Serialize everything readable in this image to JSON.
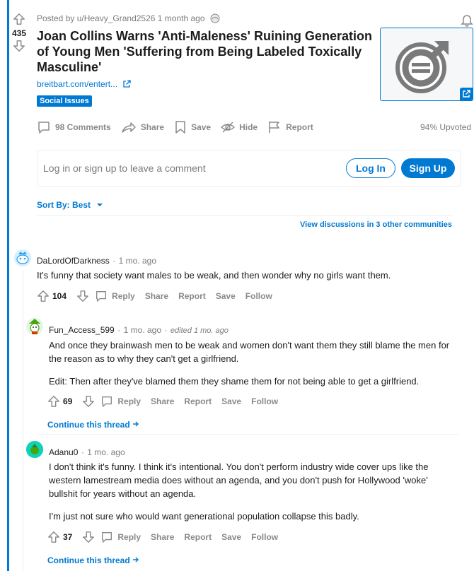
{
  "post": {
    "posted_by": "Posted by u/Heavy_Grand2526",
    "time": "1 month ago",
    "score": "435",
    "title": "Joan Collins Warns 'Anti-Maleness' Ruining Generation of Young Men 'Suffering from Being Labeled Toxically Masculine'",
    "domain": "breitbart.com/entert...",
    "flair": "Social Issues",
    "comments_label": "98 Comments",
    "share_label": "Share",
    "save_label": "Save",
    "hide_label": "Hide",
    "report_label": "Report",
    "upvoted": "94% Upvoted"
  },
  "login": {
    "prompt": "Log in or sign up to leave a comment",
    "login_label": "Log In",
    "signup_label": "Sign Up"
  },
  "sort": {
    "label": "Sort By: Best"
  },
  "view_discussions": "View discussions in 3 other communities",
  "comments": [
    {
      "author": "DaLordOfDarkness",
      "time": "1 mo. ago",
      "text": "It's funny that society want males to be weak, and then wonder why no girls want them.",
      "score": "104",
      "reply": "Reply",
      "share": "Share",
      "report": "Report",
      "save": "Save",
      "follow": "Follow"
    },
    {
      "author": "Fun_Access_599",
      "time": "1 mo. ago",
      "edited": "edited 1 mo. ago",
      "text1": "And once they brainwash men to be weak and women don't want them they still blame the men for the reason as to why they can't get a girlfriend.",
      "text2": "Edit: Then after they've blamed them they shame them for not being able to get a girlfriend.",
      "score": "69",
      "reply": "Reply",
      "share": "Share",
      "report": "Report",
      "save": "Save",
      "follow": "Follow",
      "continue": "Continue this thread"
    },
    {
      "author": "Adanu0",
      "time": "1 mo. ago",
      "text1": "I don't think it's funny. I think it's intentional. You don't perform industry wide cover ups like the western lamestream media does without an agenda, and you don't push for Hollywood 'woke' bullshit for years without an agenda.",
      "text2": "I'm just not sure who would want generational population collapse this badly.",
      "score": "37",
      "reply": "Reply",
      "share": "Share",
      "report": "Report",
      "save": "Save",
      "follow": "Follow",
      "continue": "Continue this thread"
    }
  ],
  "colors": {
    "accent": "#0079d3",
    "muted": "#878a8c",
    "text": "#1c1c1c"
  },
  "icons": [
    "upvote-icon",
    "downvote-icon",
    "comment-icon",
    "share-icon",
    "save-icon",
    "hide-icon",
    "report-icon",
    "external-link-icon",
    "chevron-down-icon",
    "bell-icon",
    "male-symbol-icon"
  ]
}
